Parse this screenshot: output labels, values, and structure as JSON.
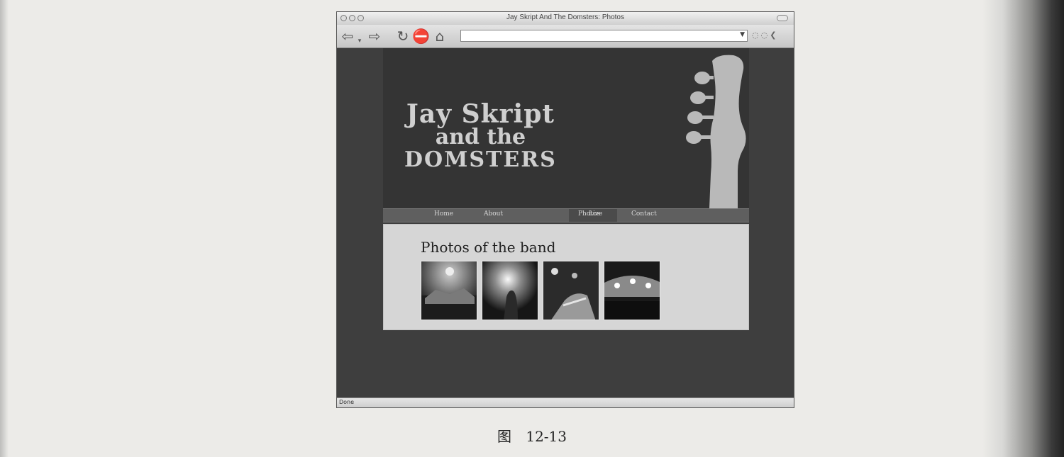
{
  "browser": {
    "window_title": "Jay Skript And The Domsters: Photos",
    "url": "",
    "status_text": "Done"
  },
  "site": {
    "title_line1": "Jay Skript",
    "title_line2": "and the",
    "title_line3": "DOMSTERS",
    "nav": [
      {
        "label": "Home"
      },
      {
        "label": "About"
      },
      {
        "label": "Photos"
      },
      {
        "label": "Live"
      },
      {
        "label": "Contact"
      }
    ],
    "active_nav": "Photos",
    "heading": "Photos of the band",
    "photos": [
      {
        "alt": "concert-stage-photo"
      },
      {
        "alt": "performer-in-spotlight-photo"
      },
      {
        "alt": "guitarist-on-stage-photo"
      },
      {
        "alt": "crowd-under-lights-photo"
      }
    ]
  },
  "figure_caption": {
    "label": "图",
    "number": "12-13"
  },
  "colors": {
    "page_background": "#3e3e3e",
    "header_background": "#343434",
    "title_color": "#cfcfcf",
    "content_background": "#d6d6d6",
    "nav_background": "#5f5f5f"
  }
}
